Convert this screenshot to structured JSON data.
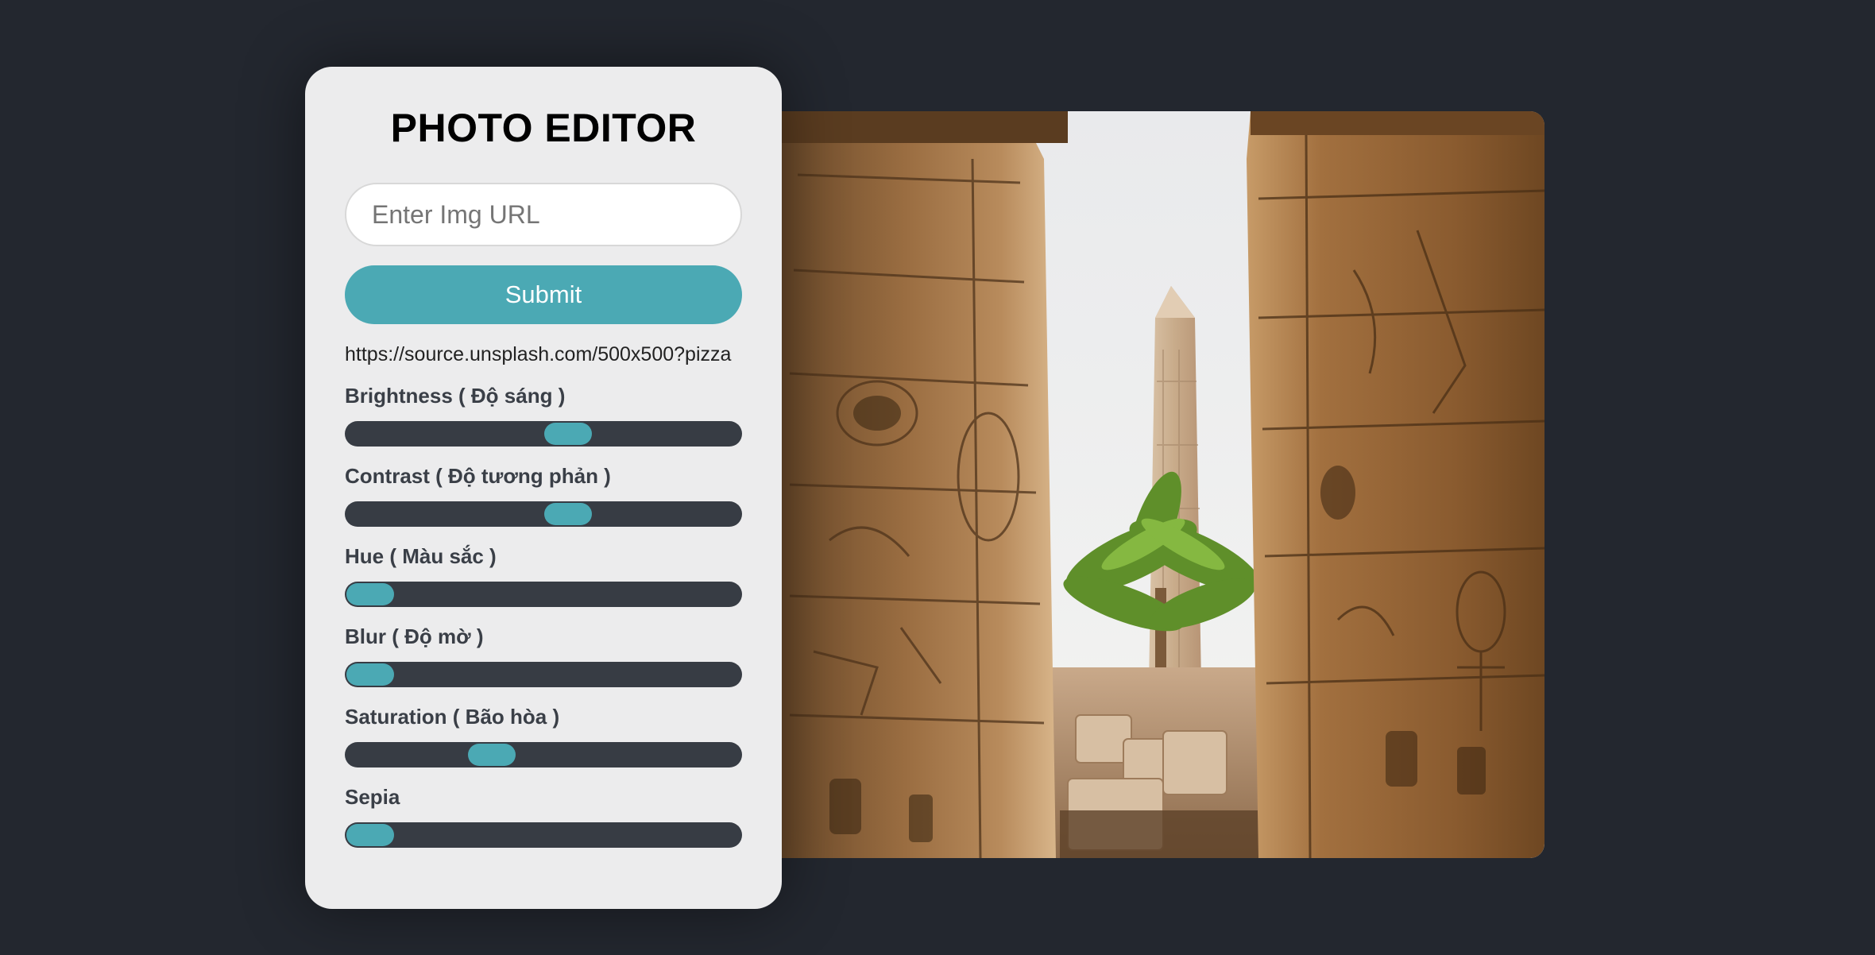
{
  "app": {
    "title": "PHOTO EDITOR"
  },
  "url_form": {
    "placeholder": "Enter Img URL",
    "value": "",
    "submit_label": "Submit",
    "current_url": "https://source.unsplash.com/500x500?pizza"
  },
  "controls": [
    {
      "label": "Brightness ( Độ sáng )",
      "level": 0.57
    },
    {
      "label": "Contrast ( Độ tương phản )",
      "level": 0.57
    },
    {
      "label": "Hue ( Màu sắc )",
      "level": 0.0
    },
    {
      "label": "Blur ( Độ mờ )",
      "level": 0.0
    },
    {
      "label": "Saturation ( Bão hòa )",
      "level": 0.35
    },
    {
      "label": "Sepia",
      "level": 0.0
    }
  ],
  "colors": {
    "background": "#23272f",
    "panel": "#ececed",
    "accent": "#4ba9b4",
    "track": "#373c44"
  }
}
